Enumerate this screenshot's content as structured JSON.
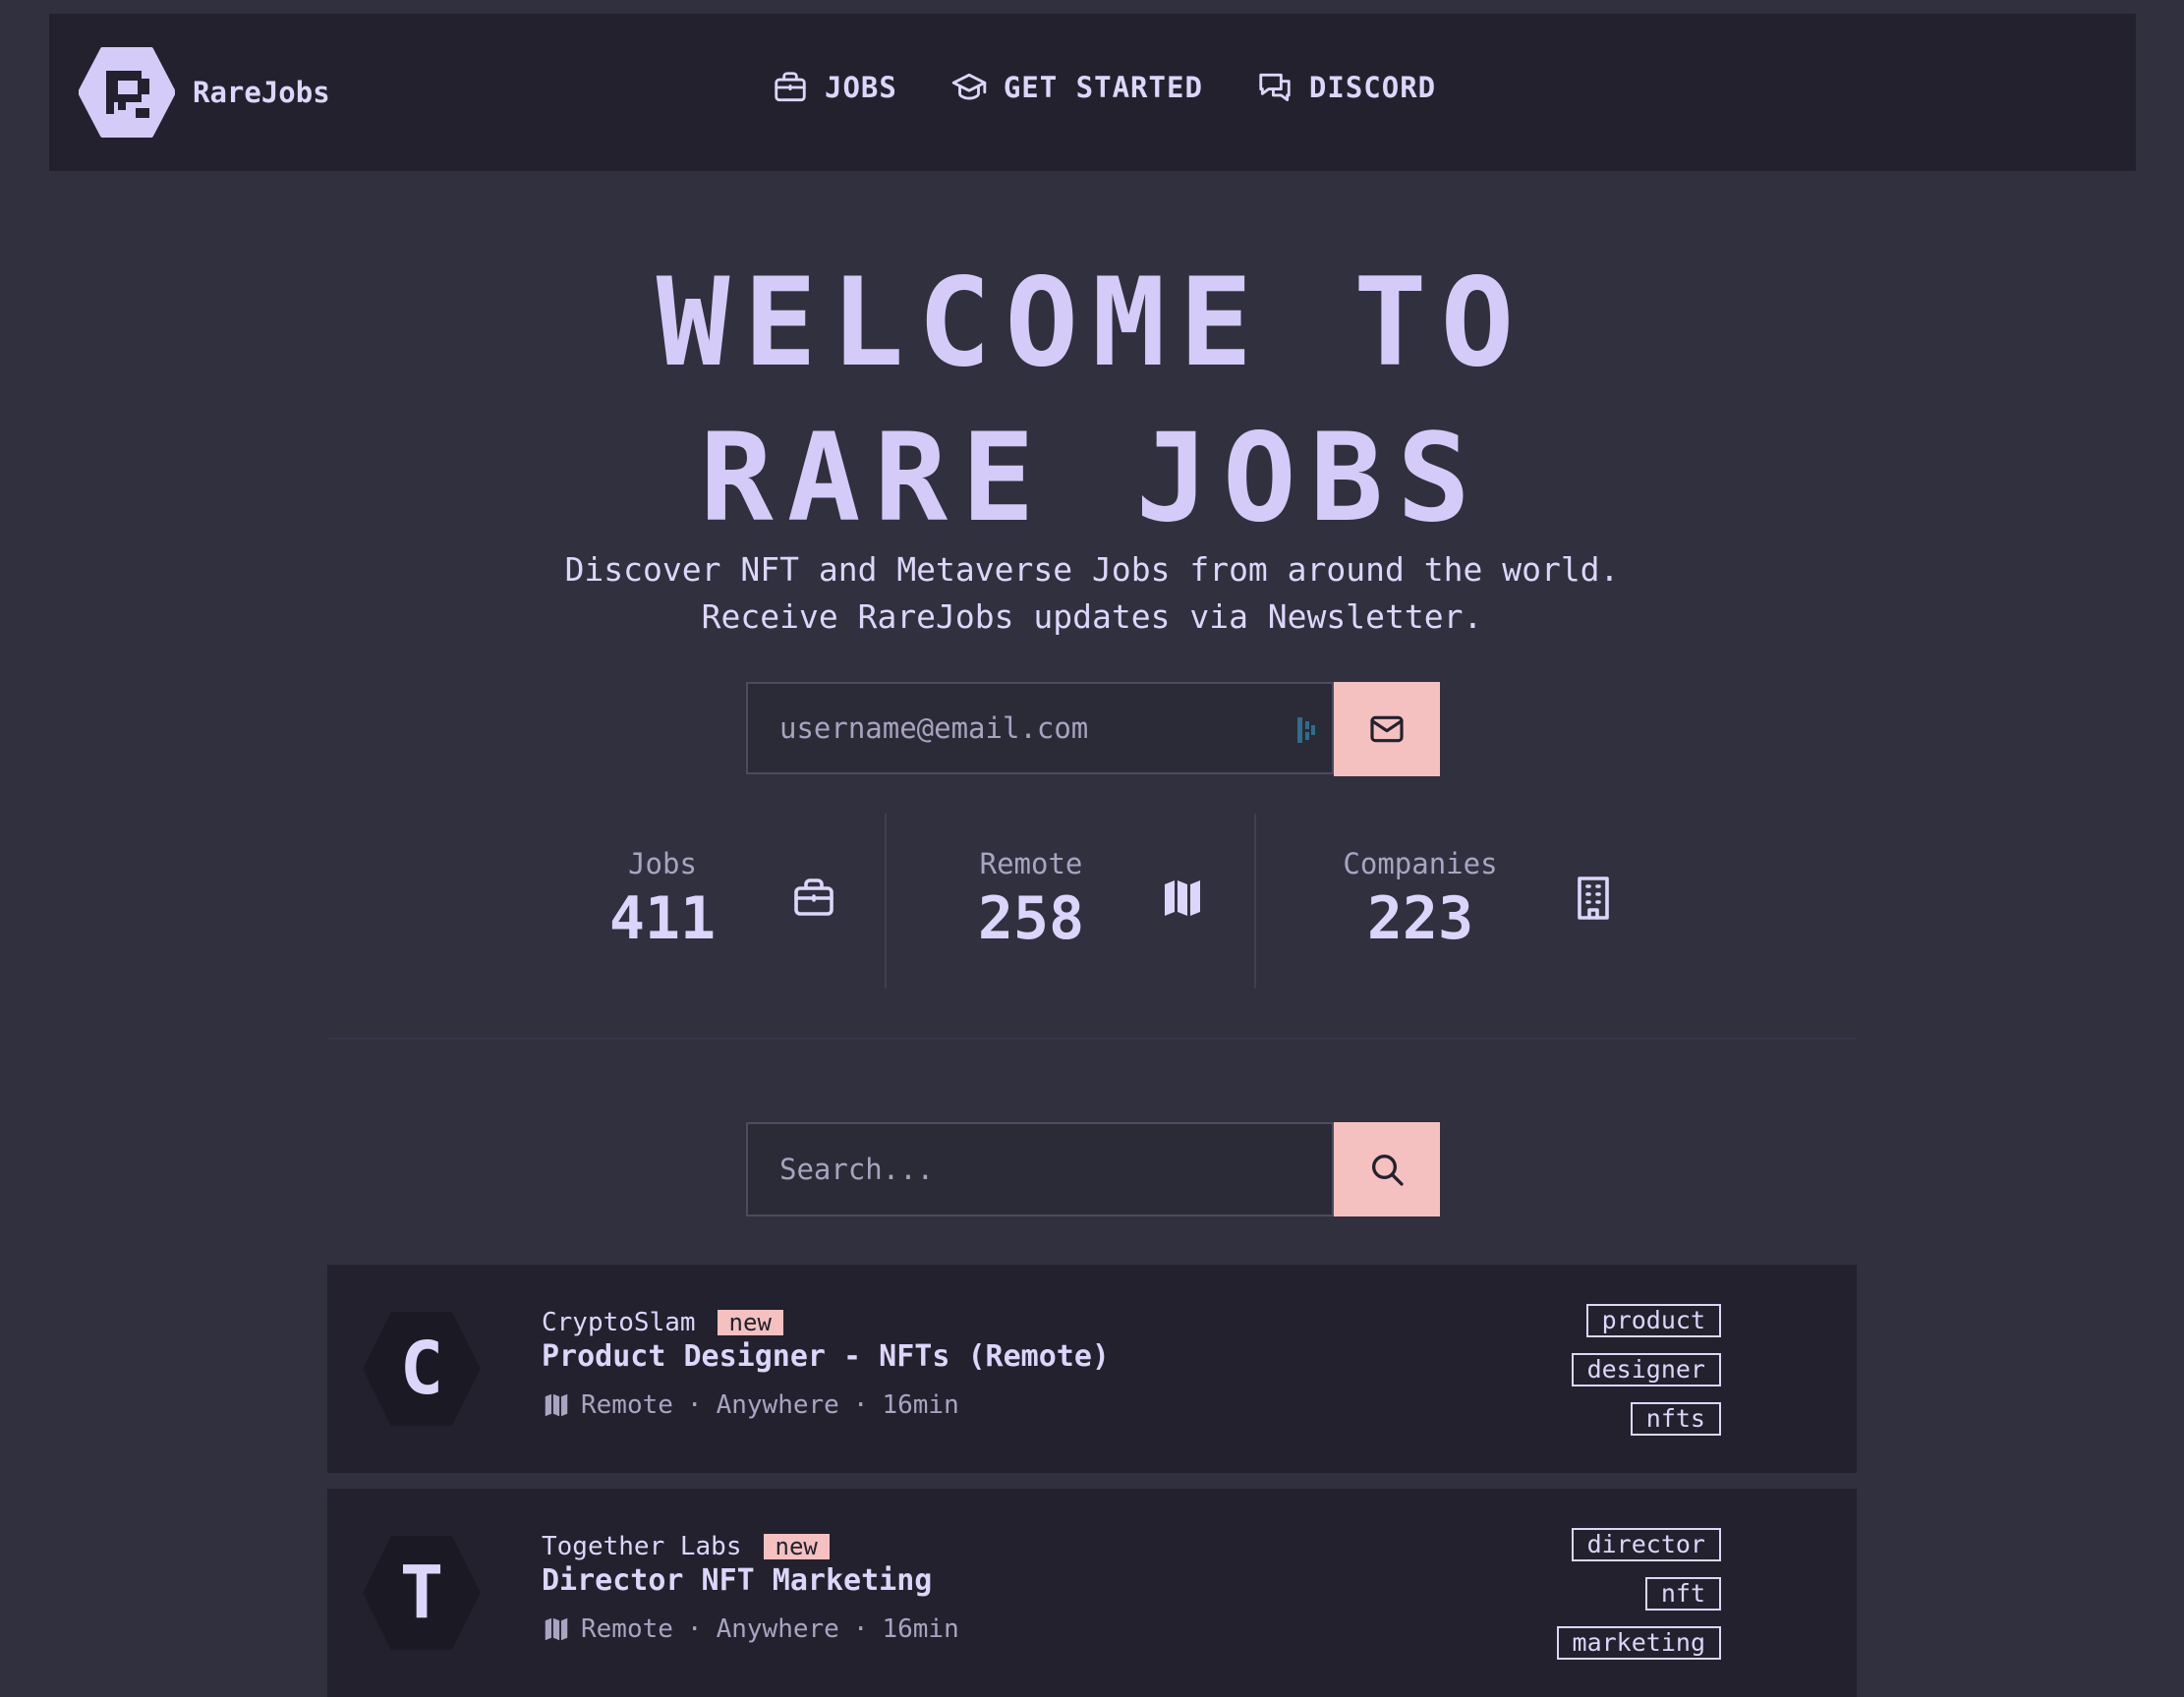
{
  "header": {
    "brand": "RareJobs",
    "nav": [
      {
        "label": "JOBS",
        "icon": "briefcase-icon"
      },
      {
        "label": "GET STARTED",
        "icon": "graduation-cap-icon"
      },
      {
        "label": "DISCORD",
        "icon": "chat-bubbles-icon"
      }
    ]
  },
  "hero": {
    "title_line1": "WELCOME TO",
    "title_line2": "RARE JOBS",
    "subtitle_line1": "Discover NFT and Metaverse Jobs from around the world.",
    "subtitle_line2": "Receive RareJobs updates via Newsletter."
  },
  "newsletter": {
    "placeholder": "username@email.com",
    "button_icon": "mail-icon"
  },
  "stats": [
    {
      "label": "Jobs",
      "value": "411",
      "icon": "briefcase-icon"
    },
    {
      "label": "Remote",
      "value": "258",
      "icon": "map-icon"
    },
    {
      "label": "Companies",
      "value": "223",
      "icon": "building-icon"
    }
  ],
  "search": {
    "placeholder": "Search...",
    "button_icon": "search-icon"
  },
  "jobs": [
    {
      "initial": "C",
      "company": "CryptoSlam",
      "badge": "new",
      "title": "Product Designer - NFTs (Remote)",
      "type": "Remote",
      "location": "Anywhere",
      "age": "16min",
      "tags": [
        "product",
        "designer",
        "nfts"
      ]
    },
    {
      "initial": "T",
      "company": "Together Labs",
      "badge": "new",
      "title": "Director NFT Marketing",
      "type": "Remote",
      "location": "Anywhere",
      "age": "16min",
      "tags": [
        "director",
        "nft",
        "marketing"
      ]
    }
  ],
  "colors": {
    "background": "#31303f",
    "panel": "#23212e",
    "accent": "#f4c1c0",
    "text": "#ddd6fb",
    "muted": "#a9a4c2"
  },
  "separator": "·"
}
